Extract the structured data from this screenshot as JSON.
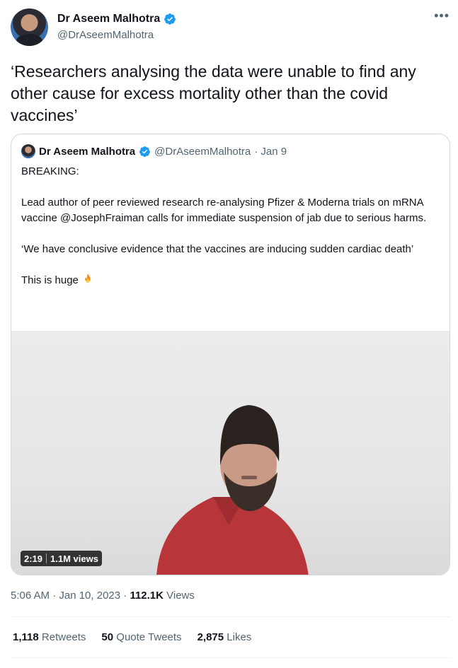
{
  "author": {
    "name": "Dr Aseem Malhotra",
    "handle": "@DrAseemMalhotra"
  },
  "more_icon": "more-horizontal-icon",
  "tweet_text": "‘Researchers analysing the data were unable to find any other cause for excess mortality other than the covid vaccines’",
  "quoted": {
    "name": "Dr Aseem Malhotra",
    "handle": "@DrAseemMalhotra",
    "date": "· Jan 9",
    "para1": "BREAKING:",
    "para2": "Lead author of peer reviewed research re-analysing Pfizer & Moderna trials on mRNA vaccine @JosephFraiman calls for immediate suspension of jab due to serious harms.",
    "para3": "‘We have conclusive evidence that the vaccines are inducing sudden cardiac death’",
    "para4": "This is huge",
    "emoji": "fire-icon",
    "video": {
      "duration": "2:19",
      "views": "1.1M views"
    }
  },
  "meta": {
    "time": "5:06 AM · Jan 10, 2023 · ",
    "views_count": "112.1K",
    "views_label": " Views"
  },
  "stats": {
    "retweets_count": "1,118",
    "retweets_label": "Retweets",
    "quotes_count": "50",
    "quotes_label": "Quote Tweets",
    "likes_count": "2,875",
    "likes_label": "Likes"
  },
  "colors": {
    "verified": "#1d9bf0",
    "secondary_text": "#536471",
    "border": "#cfd9de"
  }
}
